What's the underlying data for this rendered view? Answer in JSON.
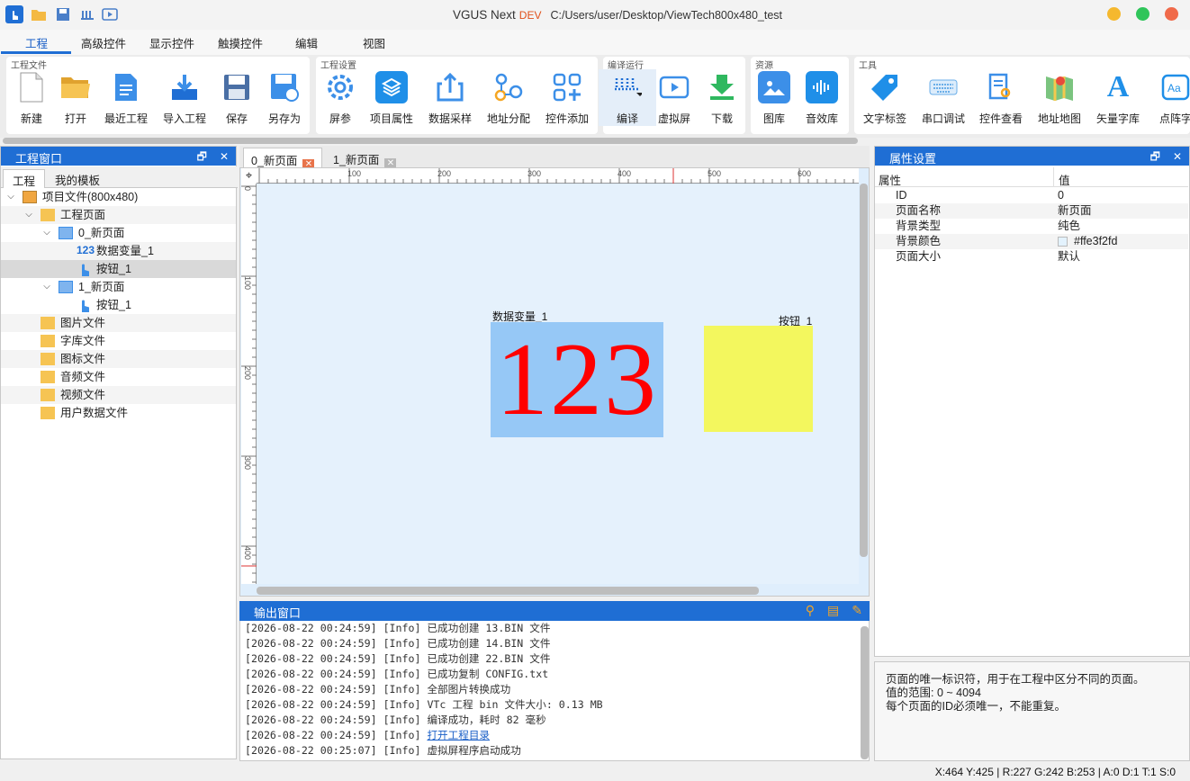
{
  "titlebar": {
    "app": "VGUS Next",
    "edition": "DEV",
    "path": "C:/Users/user/Desktop/ViewTech800x480_test"
  },
  "menu": [
    "工程",
    "高级控件",
    "显示控件",
    "触摸控件",
    "编辑",
    "视图"
  ],
  "ribbon": {
    "project_file": {
      "label": "工程文件",
      "tools": [
        "新建",
        "打开",
        "最近工程",
        "导入工程",
        "保存",
        "另存为"
      ]
    },
    "project_settings": {
      "label": "工程设置",
      "tools": [
        "屏参",
        "项目属性",
        "数据采样",
        "地址分配",
        "控件添加"
      ]
    },
    "compile_run": {
      "label": "编译运行",
      "tools": [
        "编译",
        "虚拟屏",
        "下载"
      ]
    },
    "resources": {
      "label": "资源",
      "tools": [
        "图库",
        "音效库"
      ]
    },
    "tools": {
      "label": "工具",
      "tools": [
        "文字标签",
        "串口调试",
        "控件查看",
        "地址地图",
        "矢量字库",
        "点阵字"
      ]
    }
  },
  "left_panel": {
    "title": "工程窗口",
    "tabs": [
      "工程",
      "我的模板"
    ],
    "tree": [
      "项目文件(800x480)",
      "工程页面",
      "0_新页面",
      "数据变量_1",
      "按钮_1",
      "1_新页面",
      "按钮_1",
      "图片文件",
      "字库文件",
      "图标文件",
      "音频文件",
      "视频文件",
      "用户数据文件"
    ]
  },
  "editor": {
    "tabs": [
      "0_新页面",
      "1_新页面"
    ],
    "ruler_h": [
      "100",
      "200",
      "300",
      "400",
      "500",
      "600"
    ],
    "ruler_v": [
      "0",
      "100",
      "200",
      "300",
      "400"
    ],
    "number_control": {
      "label": "数据变量_1",
      "value": "123"
    },
    "button_control": {
      "label": "按钮_1"
    }
  },
  "output": {
    "title": "输出窗口",
    "lines": [
      {
        "time": "[2026-08-22 00:24:59]",
        "level": "[Info]",
        "msg": "已成功创建 13.BIN 文件"
      },
      {
        "time": "[2026-08-22 00:24:59]",
        "level": "[Info]",
        "msg": "已成功创建 14.BIN 文件"
      },
      {
        "time": "[2026-08-22 00:24:59]",
        "level": "[Info]",
        "msg": "已成功创建 22.BIN 文件"
      },
      {
        "time": "[2026-08-22 00:24:59]",
        "level": "[Info]",
        "msg": "已成功复制 CONFIG.txt"
      },
      {
        "time": "[2026-08-22 00:24:59]",
        "level": "[Info]",
        "msg": "全部图片转换成功"
      },
      {
        "time": "[2026-08-22 00:24:59]",
        "level": "[Info]",
        "msg": "VTc 工程 bin 文件大小: 0.13 MB"
      },
      {
        "time": "[2026-08-22 00:24:59]",
        "level": "[Info]",
        "msg": "编译成功，耗时 82 毫秒"
      },
      {
        "time": "[2026-08-22 00:24:59]",
        "level": "[Info]",
        "msg": "打开工程目录"
      },
      {
        "time": "[2026-08-22 00:25:07]",
        "level": "[Info]",
        "msg": "虚拟屏程序启动成功"
      }
    ]
  },
  "properties": {
    "title": "属性设置",
    "header": {
      "key": "属性",
      "value": "值"
    },
    "rows": [
      {
        "key": "ID",
        "value": "0"
      },
      {
        "key": "页面名称",
        "value": "新页面"
      },
      {
        "key": "背景类型",
        "value": "纯色"
      },
      {
        "key": "背景颜色",
        "value": "#ffe3f2fd"
      },
      {
        "key": "页面大小",
        "value": "默认"
      }
    ],
    "description": [
      "页面的唯一标识符，用于在工程中区分不同的页面。",
      "值的范围: 0 ~ 4094",
      "每个页面的ID必须唯一，不能重复。"
    ]
  },
  "status": "X:464  Y:425  |  R:227 G:242 B:253  |  A:0  D:1  T:1  S:0",
  "colors": {
    "accent": "#1f6ed4",
    "page_bg": "#e3f2fd",
    "number_bg": "#96c8f6",
    "number_fg": "#ff0000",
    "button_bg": "#f3f75e"
  }
}
